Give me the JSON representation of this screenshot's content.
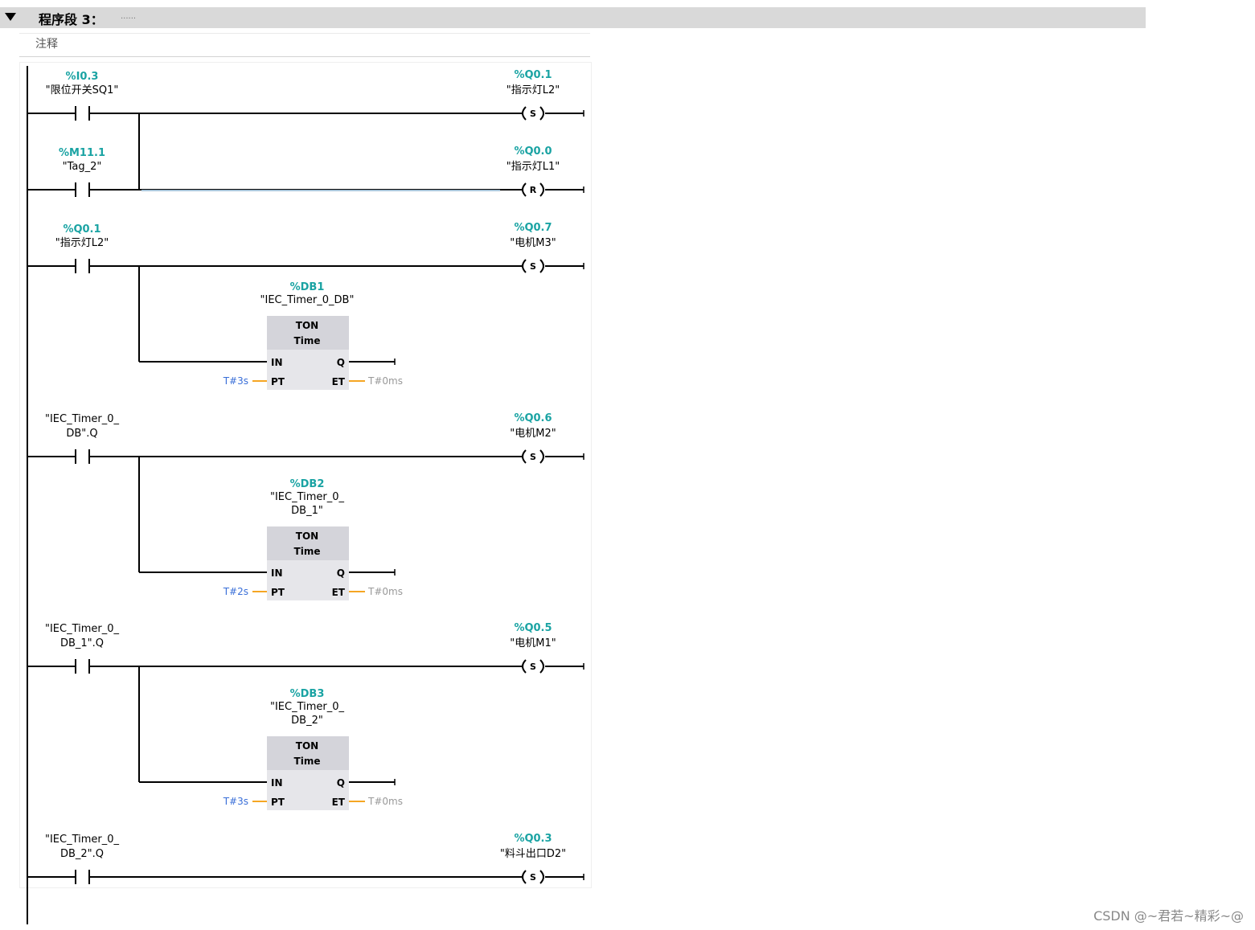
{
  "network": {
    "title": "程序段 3：",
    "dots": "......",
    "comment": "注释"
  },
  "rungs": [
    {
      "contact": {
        "addr": "%I0.3",
        "name": [
          "\"限位开关SQ1\""
        ]
      },
      "coil": {
        "addr": "%Q0.1",
        "name": "\"指示灯L2\"",
        "type": "S"
      }
    },
    {
      "contact": {
        "addr": "%M11.1",
        "name": [
          "\"Tag_2\""
        ]
      },
      "coil": {
        "addr": "%Q0.0",
        "name": "\"指示灯L1\"",
        "type": "R"
      }
    },
    {
      "contact": {
        "addr": "%Q0.1",
        "name": [
          "\"指示灯L2\""
        ]
      },
      "coil": {
        "addr": "%Q0.7",
        "name": "\"电机M3\"",
        "type": "S"
      },
      "timer": {
        "db": "%DB1",
        "name": [
          "\"IEC_Timer_0_DB\""
        ],
        "type": "TON",
        "subtype": "Time",
        "pins": {
          "in": "IN",
          "q": "Q",
          "pt": "PT",
          "et": "ET"
        },
        "pt_value": "T#3s",
        "et_value": "T#0ms"
      }
    },
    {
      "contact": {
        "addr": "",
        "name": [
          "\"IEC_Timer_0_",
          "DB\".Q"
        ]
      },
      "coil": {
        "addr": "%Q0.6",
        "name": "\"电机M2\"",
        "type": "S"
      },
      "timer": {
        "db": "%DB2",
        "name": [
          "\"IEC_Timer_0_",
          "DB_1\""
        ],
        "type": "TON",
        "subtype": "Time",
        "pins": {
          "in": "IN",
          "q": "Q",
          "pt": "PT",
          "et": "ET"
        },
        "pt_value": "T#2s",
        "et_value": "T#0ms"
      }
    },
    {
      "contact": {
        "addr": "",
        "name": [
          "\"IEC_Timer_0_",
          "DB_1\".Q"
        ]
      },
      "coil": {
        "addr": "%Q0.5",
        "name": "\"电机M1\"",
        "type": "S"
      },
      "timer": {
        "db": "%DB3",
        "name": [
          "\"IEC_Timer_0_",
          "DB_2\""
        ],
        "type": "TON",
        "subtype": "Time",
        "pins": {
          "in": "IN",
          "q": "Q",
          "pt": "PT",
          "et": "ET"
        },
        "pt_value": "T#3s",
        "et_value": "T#0ms"
      }
    },
    {
      "contact": {
        "addr": "",
        "name": [
          "\"IEC_Timer_0_",
          "DB_2\".Q"
        ]
      },
      "coil": {
        "addr": "%Q0.3",
        "name": "\"料斗出口D2\"",
        "type": "S"
      }
    }
  ],
  "watermark": "CSDN @~君若~精彩~@",
  "colors": {
    "address": "#1aa3a3",
    "pt_value": "#3a6fd8",
    "et_value": "#999999",
    "pin_line": "#f5a623",
    "timer_box": "#e6e6ea",
    "timer_header": "#d4d4da"
  }
}
